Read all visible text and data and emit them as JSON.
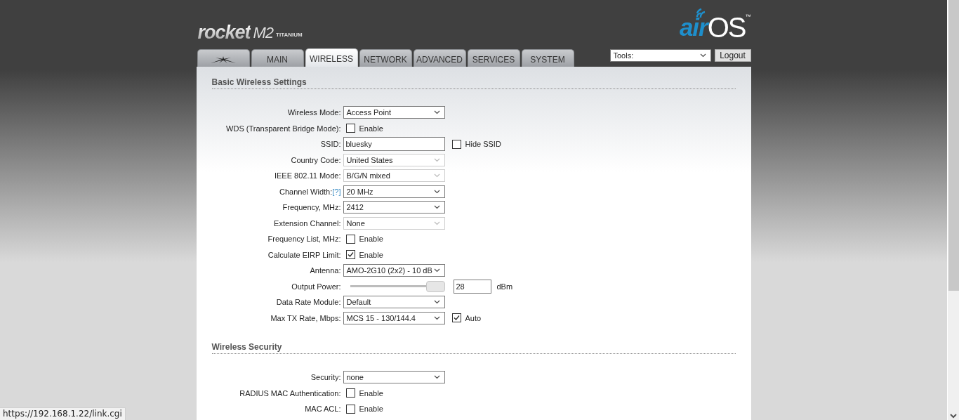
{
  "header": {
    "product_logo": {
      "name": "rocket",
      "model": "M2",
      "edition": "TITANIUM"
    },
    "brand_logo": {
      "prefix": "air",
      "name": "OS",
      "mark": "™"
    }
  },
  "tabs": [
    {
      "kind": "icon",
      "selected": false
    },
    {
      "kind": "text",
      "label": "MAIN",
      "selected": false
    },
    {
      "kind": "text",
      "label": "WIRELESS",
      "selected": true
    },
    {
      "kind": "text",
      "label": "NETWORK",
      "selected": false
    },
    {
      "kind": "text",
      "label": "ADVANCED",
      "selected": false
    },
    {
      "kind": "text",
      "label": "SERVICES",
      "selected": false
    },
    {
      "kind": "text",
      "label": "SYSTEM",
      "selected": false
    }
  ],
  "tools": {
    "value": "Tools:"
  },
  "logout_button": "Logout",
  "sections": [
    {
      "title": "Basic Wireless Settings",
      "rows": [
        {
          "kind": "select",
          "label": "Wireless Mode:",
          "value": "Access Point",
          "disabled": false
        },
        {
          "kind": "checkbox",
          "label": "WDS (Transparent Bridge Mode):",
          "text": "Enable",
          "checked": false
        },
        {
          "kind": "text",
          "label": "SSID:",
          "value": "bluesky",
          "extra": {
            "text": "Hide SSID",
            "checked": false
          }
        },
        {
          "kind": "select",
          "label": "Country Code:",
          "value": "United States",
          "disabled": true
        },
        {
          "kind": "select",
          "label": "IEEE 802.11 Mode:",
          "value": "B/G/N mixed",
          "disabled": true
        },
        {
          "kind": "select",
          "label": "Channel Width:",
          "help": "[?]",
          "value": "20 MHz",
          "disabled": false
        },
        {
          "kind": "select",
          "label": "Frequency, MHz:",
          "value": "2412",
          "disabled": false
        },
        {
          "kind": "select",
          "label": "Extension Channel:",
          "value": "None",
          "disabled": true
        },
        {
          "kind": "checkbox",
          "label": "Frequency List, MHz:",
          "text": "Enable",
          "checked": false
        },
        {
          "kind": "checkbox",
          "label": "Calculate EIRP Limit:",
          "text": "Enable",
          "checked": true
        },
        {
          "kind": "select",
          "label": "Antenna:",
          "value": "AMO-2G10 (2x2) - 10 dB",
          "disabled": false
        },
        {
          "kind": "slider",
          "label": "Output Power:",
          "level": 1,
          "value": "28",
          "unit": "dBm"
        },
        {
          "kind": "select",
          "label": "Data Rate Module:",
          "value": "Default",
          "disabled": false
        },
        {
          "kind": "select",
          "label": "Max TX Rate, Mbps:",
          "value": "MCS 15 - 130/144.4",
          "disabled": false,
          "extra": {
            "text": "Auto",
            "checked": true
          }
        }
      ]
    },
    {
      "title": "Wireless Security",
      "rows": [
        {
          "kind": "select",
          "label": "Security:",
          "value": "none",
          "disabled": false
        },
        {
          "kind": "checkbox",
          "label": "RADIUS MAC Authentication:",
          "text": "Enable",
          "checked": false
        },
        {
          "kind": "checkbox",
          "label": "MAC ACL:",
          "text": "Enable",
          "checked": false
        }
      ]
    }
  ],
  "status_url": "https://192.168.1.22/link.cgi"
}
